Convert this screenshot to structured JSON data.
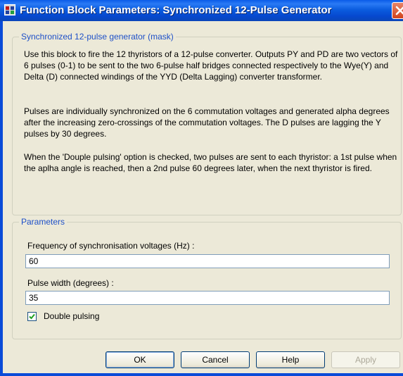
{
  "window": {
    "title": "Function Block Parameters:  Synchronized 12-Pulse Generator",
    "close_label": "Close"
  },
  "mask": {
    "legend": "Synchronized 12-pulse generator (mask)",
    "paragraph_1": "Use this block to fire the 12 thyristors of a 12-pulse converter. Outputs PY and PD are two vectors of 6 pulses (0-1) to be sent to the two 6-pulse half bridges connected respectively to the Wye(Y) and Delta (D) connected windings of the YYD (Delta Lagging)  converter transformer.",
    "paragraph_2": "Pulses are individually synchronized on the 6 commutation voltages and generated alpha degrees after the increasing zero-crossings of the commutation voltages. The D pulses are lagging the Y pulses by  30 degrees.",
    "paragraph_3": "When the 'Douple pulsing' option is checked, two pulses are sent to each thyristor: a 1st pulse when the aplha angle is reached, then a 2nd pulse 60 degrees later, when the next thyristor is fired."
  },
  "parameters": {
    "legend": "Parameters",
    "frequency": {
      "label": "Frequency of synchronisation voltages (Hz) :",
      "value": "60"
    },
    "pulse_width": {
      "label": "Pulse width (degrees) :",
      "value": "35"
    },
    "double_pulsing": {
      "label": "Double pulsing",
      "checked": true
    }
  },
  "buttons": {
    "ok": "OK",
    "cancel": "Cancel",
    "help": "Help",
    "apply": "Apply"
  }
}
